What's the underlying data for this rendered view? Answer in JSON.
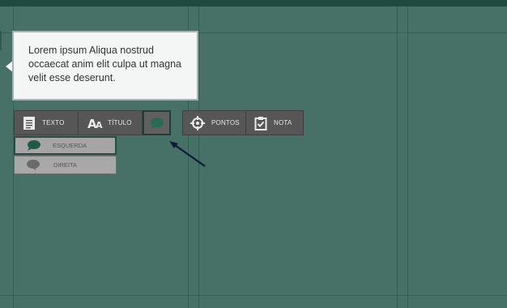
{
  "bubble": {
    "text": "Lorem ipsum Aliqua nostrud occaecat anim elit culpa ut magna velit esse deserunt."
  },
  "toolbar": {
    "texto_label": "TEXTO",
    "titulo_label": "TÍTULO",
    "pontos_label": "PONTOS",
    "nota_label": "NOTA"
  },
  "balloon_menu": {
    "items": [
      {
        "label": "ESQUERDA",
        "icon": "speech-bubble-left-icon",
        "selected": true
      },
      {
        "label": "DIREITA",
        "icon": "speech-bubble-right-icon",
        "selected": false
      }
    ]
  },
  "colors": {
    "canvas": "#477066",
    "topbar": "#1f4a3f",
    "button": "#565656",
    "accent_green": "#2a6a55",
    "submenu": "#a5a5a5"
  }
}
